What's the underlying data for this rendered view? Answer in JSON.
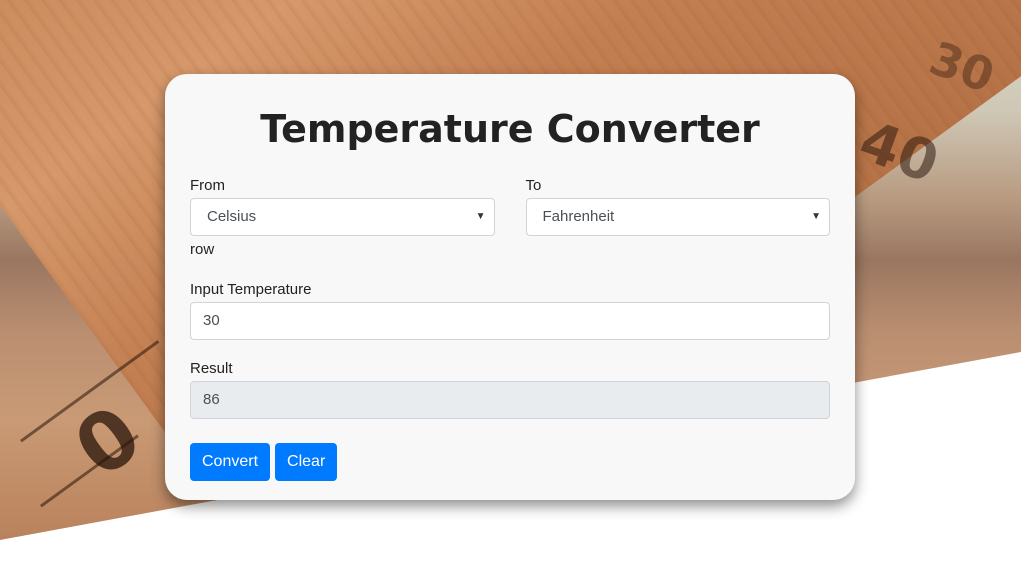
{
  "app": {
    "title": "Temperature Converter"
  },
  "form": {
    "from": {
      "label": "From",
      "selected": "Celsius"
    },
    "to": {
      "label": "To",
      "selected": "Fahrenheit"
    },
    "row_note": "row",
    "input": {
      "label": "Input Temperature",
      "value": "30"
    },
    "result": {
      "label": "Result",
      "value": "86"
    }
  },
  "buttons": {
    "convert": "Convert",
    "clear": "Clear"
  },
  "colors": {
    "primary": "#007bff",
    "card": "#f8f8f8",
    "readonly": "#e9ecef"
  },
  "background": {
    "scale_numbers": [
      "0",
      "40",
      "30"
    ]
  }
}
